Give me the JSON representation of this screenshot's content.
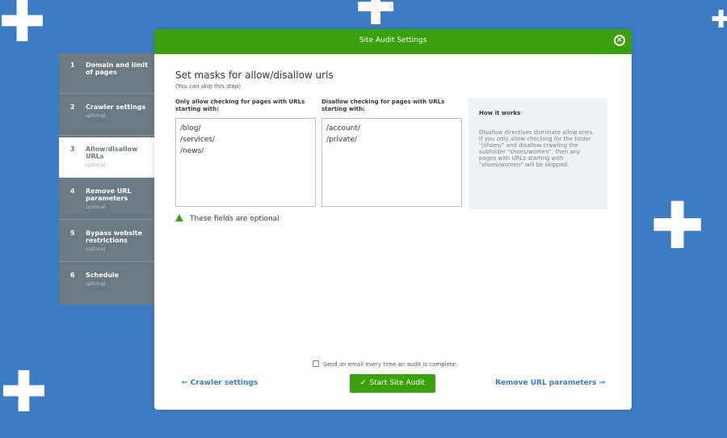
{
  "modal": {
    "title": "Site Audit Settings",
    "close_icon": "close-circle-icon"
  },
  "steps": [
    {
      "num": "1",
      "title": "Domain and limit of pages",
      "sub": ""
    },
    {
      "num": "2",
      "title": "Crawler settings",
      "sub": "optional"
    },
    {
      "num": "3",
      "title": "Allow/disallow URLs",
      "sub": "optional",
      "active": true
    },
    {
      "num": "4",
      "title": "Remove URL parameters",
      "sub": "optional"
    },
    {
      "num": "5",
      "title": "Bypass website restrictions",
      "sub": "optional"
    },
    {
      "num": "6",
      "title": "Schedule",
      "sub": "optional"
    }
  ],
  "content": {
    "heading": "Set masks for allow/disallow urls",
    "subheading": "(You can skip this step)",
    "allow_label": "Only allow checking for pages with URLs starting with:",
    "disallow_label": "Disallow checking for pages with URLs starting with:",
    "allow_values": [
      "/blog/",
      "/services/",
      "/news/"
    ],
    "disallow_values": [
      "/account/",
      "/private/"
    ],
    "optional_note": "These fields are optional"
  },
  "info": {
    "title": "How it works",
    "text": "Disallow directives dominate allow ones. If you only allow checking for the folder \"/shoes/\" and disallow crawling the subfolder \"shoes/women\", then any pages with URLs starting with \"shoes/women\" will be skipped."
  },
  "footer": {
    "email_label": "Send an email every time an audit is complete.",
    "email_checked": false,
    "back_label": "← Crawler settings",
    "start_label": "Start Site Audit",
    "next_label": "Remove URL parameters →"
  },
  "colors": {
    "background": "#3d7bc4",
    "header_green": "#3aa00e",
    "sidebar_gray": "#6d7a82",
    "link_blue": "#3d7bc4"
  }
}
